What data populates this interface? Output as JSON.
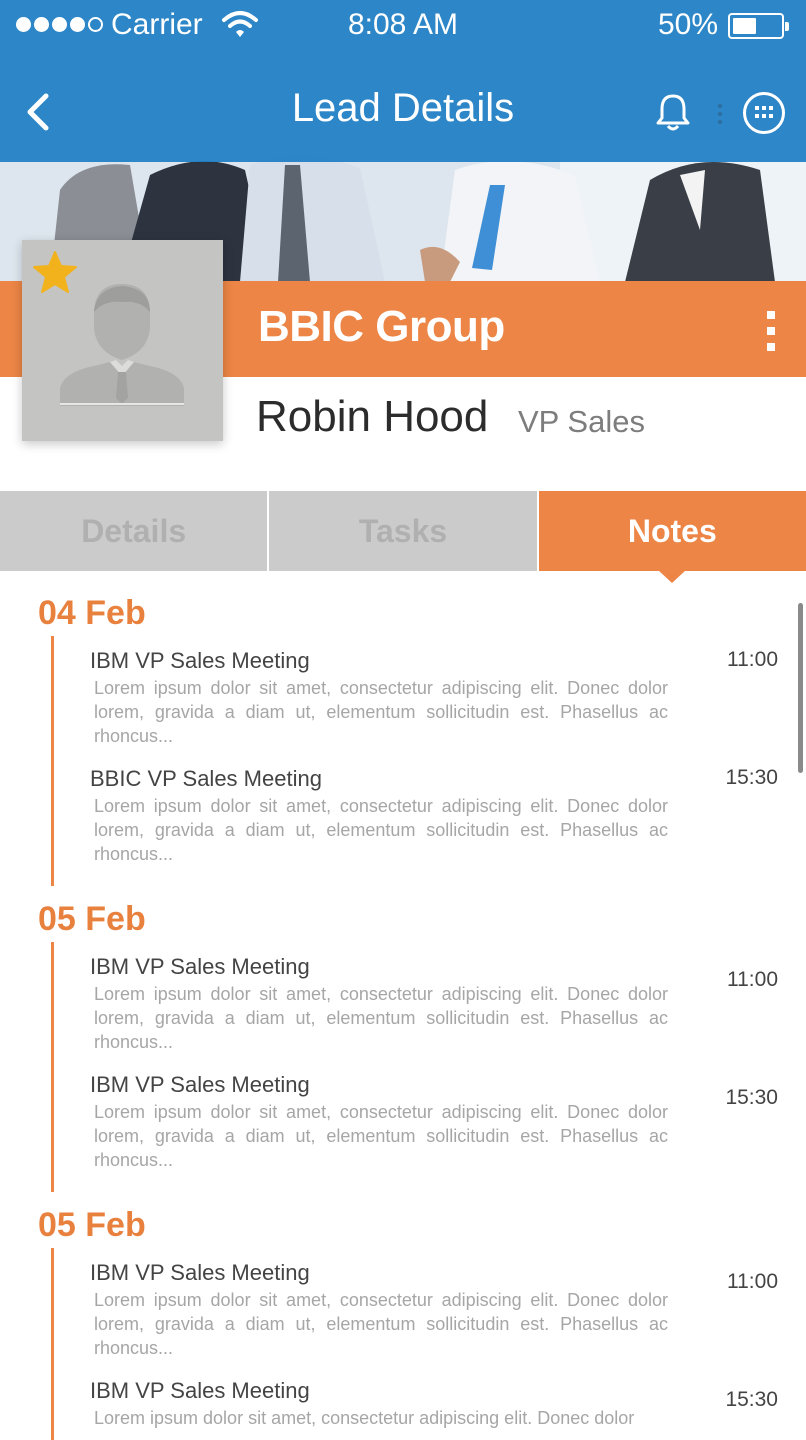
{
  "status_bar": {
    "carrier": "Carrier",
    "time": "8:08 AM",
    "battery_text": "50%",
    "battery_level": 0.5,
    "signal_bars_filled": 4,
    "signal_bars_total": 5
  },
  "nav": {
    "title": "Lead Details",
    "back_icon": "chevron-left-icon",
    "notification_icon": "bell-icon",
    "apps_icon": "apps-grid-icon"
  },
  "profile": {
    "company": "BBIC Group",
    "name": "Robin Hood",
    "role": "VP Sales",
    "favorite": true
  },
  "tabs": [
    {
      "label": "Details",
      "active": false
    },
    {
      "label": "Tasks",
      "active": false
    },
    {
      "label": "Notes",
      "active": true
    }
  ],
  "notes": [
    {
      "date": "04 Feb",
      "entries": [
        {
          "title": "IBM VP Sales Meeting",
          "time": "11:00",
          "body": "Lorem ipsum dolor sit amet, consectetur adipiscing elit. Donec dolor lorem, gravida a diam ut, elementum sollicitudin est. Phasellus ac rhoncus..."
        },
        {
          "title": "BBIC VP Sales Meeting",
          "time": "15:30",
          "body": "Lorem ipsum dolor sit amet, consectetur adipiscing elit. Donec dolor lorem, gravida a diam ut, elementum sollicitudin est. Phasellus ac rhoncus..."
        }
      ]
    },
    {
      "date": "05 Feb",
      "entries": [
        {
          "title": "IBM VP Sales Meeting",
          "time": "11:00",
          "body": "Lorem ipsum dolor sit amet, consectetur adipiscing elit. Donec dolor lorem, gravida a diam ut, elementum sollicitudin est. Phasellus ac rhoncus..."
        },
        {
          "title": "IBM VP Sales Meeting",
          "time": "15:30",
          "body": "Lorem ipsum dolor sit amet, consectetur adipiscing elit. Donec dolor lorem, gravida a diam ut, elementum sollicitudin est. Phasellus ac rhoncus..."
        }
      ]
    },
    {
      "date": "05 Feb",
      "entries": [
        {
          "title": "IBM VP Sales Meeting",
          "time": "11:00",
          "body": "Lorem ipsum dolor sit amet, consectetur adipiscing elit. Donec dolor lorem, gravida a diam ut, elementum sollicitudin est. Phasellus ac rhoncus..."
        },
        {
          "title": "IBM VP Sales Meeting",
          "time": "15:30",
          "body": "Lorem ipsum dolor sit amet, consectetur adipiscing elit. Donec dolor"
        }
      ]
    }
  ],
  "colors": {
    "header_blue": "#1e7ec4",
    "accent_orange": "#ec8545",
    "tab_inactive": "#cbcbcb",
    "avatar_gray": "#c4c4c2",
    "star_yellow": "#f2b21c"
  }
}
